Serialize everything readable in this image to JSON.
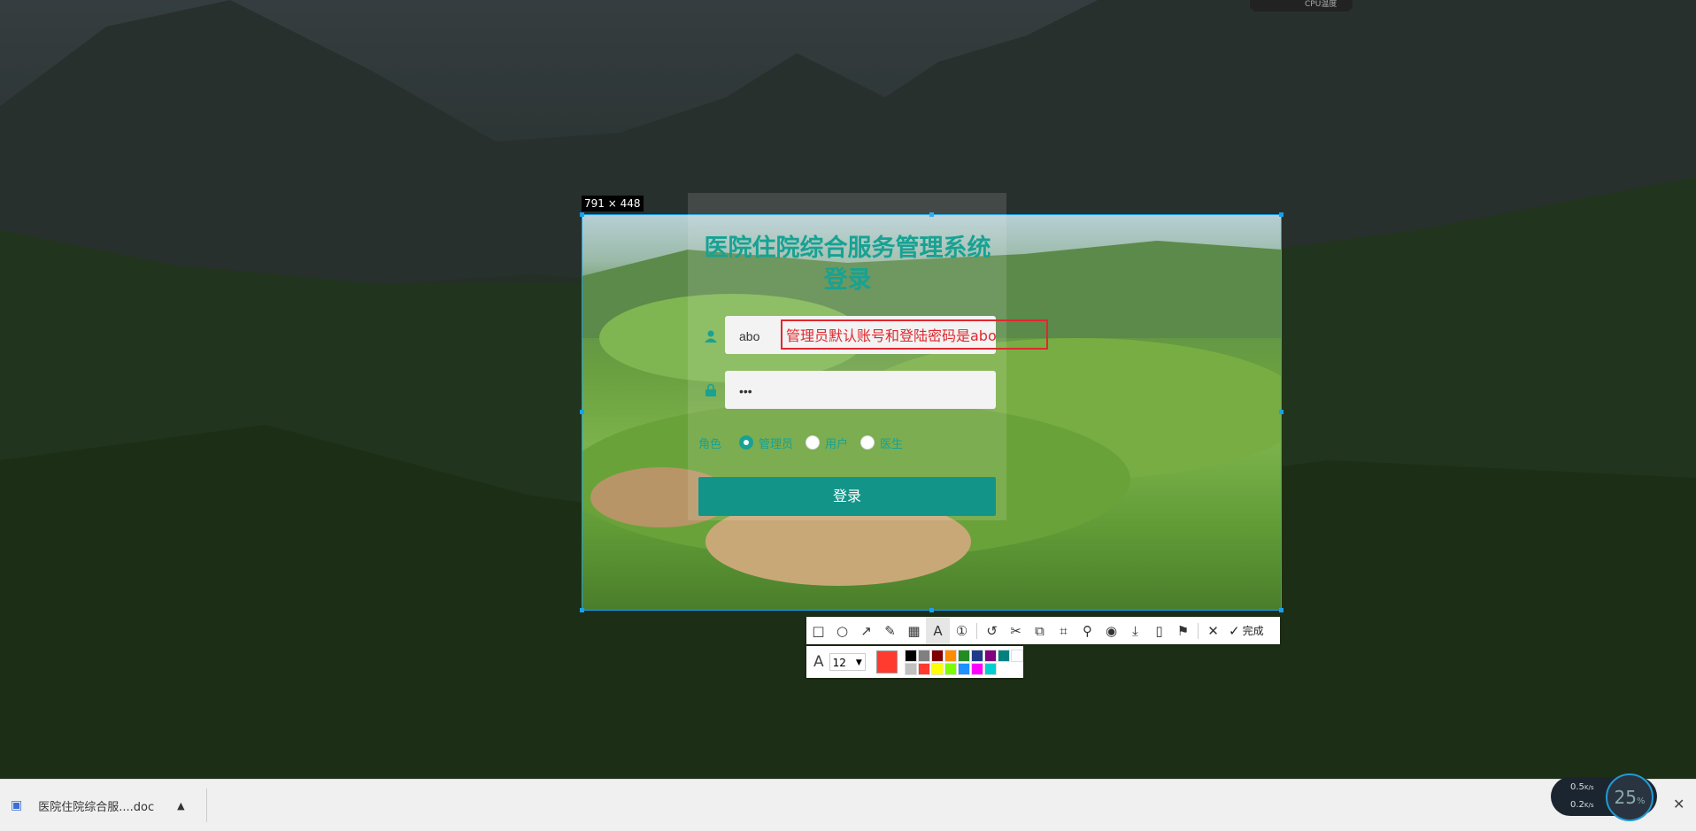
{
  "selection": {
    "size_label": "791 × 448"
  },
  "login": {
    "title": "医院住院综合服务管理系统登录",
    "username_value": "abo",
    "password_value": "•••",
    "role_label": "角色",
    "roles": [
      "管理员",
      "用户",
      "医生"
    ],
    "selected_role": "管理员",
    "login_button": "登录"
  },
  "annotation": {
    "text": "管理员默认账号和登陆密码是abo",
    "color": "#e0282e"
  },
  "toolbar": {
    "tools": [
      "rectangle-icon",
      "ellipse-icon",
      "arrow-icon",
      "pen-icon",
      "mosaic-icon",
      "text-icon",
      "number-icon",
      "undo-icon",
      "crop-icon",
      "translate-icon",
      "ocr-icon",
      "pin-icon",
      "record-icon",
      "download-icon",
      "long-screenshot-icon",
      "bookmark-icon"
    ],
    "done_label": "完成",
    "font_size": "12",
    "current_color": "#ff3b30",
    "palette": [
      "#000000",
      "#808080",
      "#800000",
      "#ff8c00",
      "#228b22",
      "#1e3a8a",
      "#800080",
      "#008080",
      "#ffffff",
      "#c0c0c0",
      "#ff3b30",
      "#ffff00",
      "#7cfc00",
      "#1e90ff",
      "#ff00ff",
      "#00ced1"
    ]
  },
  "taskbar": {
    "download_name": "医院住院综合服....doc"
  },
  "widgets": {
    "cpu_label": "CPU温度",
    "net_up": "0.5",
    "net_down": "0.2",
    "net_unit": "K/s",
    "percent": "25",
    "percent_unit": "%"
  }
}
